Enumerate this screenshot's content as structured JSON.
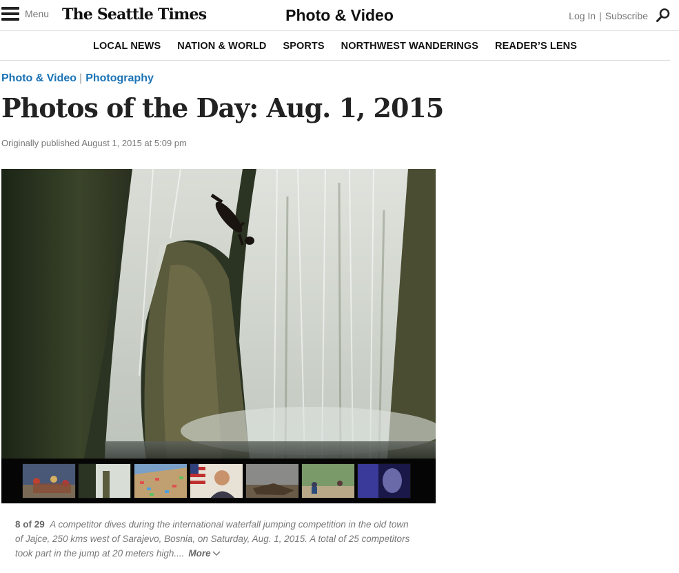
{
  "header": {
    "menu_label": "Menu",
    "logo_text": "The Seattle Times",
    "section_title": "Photo & Video",
    "login_label": "Log In",
    "account_separator": "|",
    "subscribe_label": "Subscribe"
  },
  "nav": {
    "items": [
      {
        "label": "LOCAL NEWS"
      },
      {
        "label": "NATION & WORLD"
      },
      {
        "label": "SPORTS"
      },
      {
        "label": "NORTHWEST WANDERINGS"
      },
      {
        "label": "READER’S LENS"
      }
    ]
  },
  "breadcrumb": {
    "items": [
      {
        "label": "Photo & Video"
      },
      {
        "label": "Photography"
      }
    ],
    "separator": "|"
  },
  "article": {
    "headline": "Photos of the Day: Aug. 1, 2015",
    "dateline": "Originally published August 1, 2015 at 5:09 pm"
  },
  "gallery": {
    "counter": "8 of 29",
    "caption": "A competitor dives during the international waterfall jumping competition in the old town of Jajce, 250 kms west of Sarajevo, Bosnia, on Saturday, Aug. 1, 2015. A total of 25 competitors took part in the jump at 20 meters high....",
    "more_label": "More",
    "thumbnails": [
      {
        "name": "thumb-dancers"
      },
      {
        "name": "thumb-waterfall"
      },
      {
        "name": "thumb-colorful-hillside"
      },
      {
        "name": "thumb-man-flag"
      },
      {
        "name": "thumb-beach-debris"
      },
      {
        "name": "thumb-beach-people"
      },
      {
        "name": "thumb-purple-portrait"
      }
    ]
  },
  "colors": {
    "link_blue": "#1a73b5",
    "text_dark": "#222222",
    "text_gray": "#777777"
  }
}
